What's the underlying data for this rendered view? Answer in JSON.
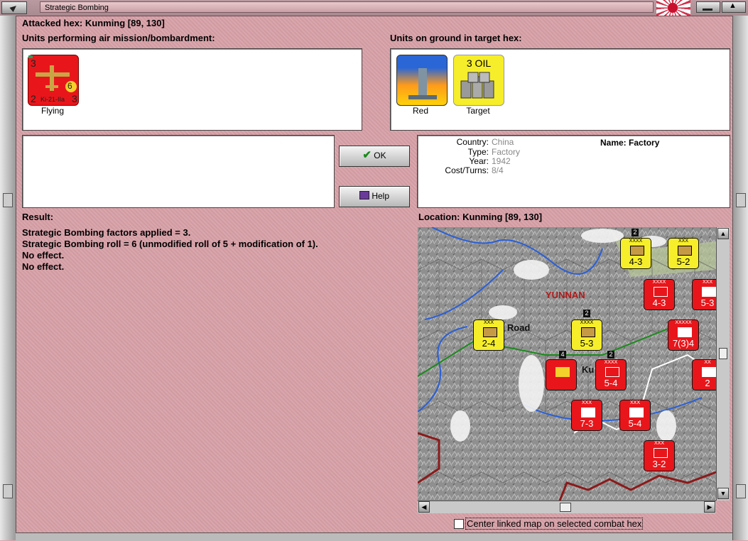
{
  "window": {
    "title": "Strategic Bombing"
  },
  "header": {
    "attacked_hex": "Attacked hex: Kunming  [89, 130]"
  },
  "air_units": {
    "label": "Units performing air mission/bombardment:",
    "items": [
      {
        "type": "Ki-21-IIa",
        "caption": "Flying",
        "top_left": "3",
        "bottom_left": "2",
        "bottom_right": "3",
        "value": "6"
      }
    ]
  },
  "ground_units": {
    "label": "Units on ground in target hex:",
    "items": [
      {
        "caption": "Red",
        "icon": "factory-smokestack-icon"
      },
      {
        "caption": "Target",
        "badge": "3 OIL",
        "icon": "oil-barrels-icon"
      }
    ]
  },
  "buttons": {
    "ok": "OK",
    "help": "Help"
  },
  "info": {
    "country_label": "Country:",
    "country": "China",
    "type_label": "Type:",
    "type": "Factory",
    "year_label": "Year:",
    "year": "1942",
    "cost_label": "Cost/Turns:",
    "cost": "8/4",
    "name_label": "Name: Factory"
  },
  "result": {
    "label": "Result:",
    "lines": [
      "Strategic Bombing factors applied = 3.",
      "Strategic Bombing roll = 6 (unmodified roll of 5 + modification of 1).",
      "No effect.",
      "No effect."
    ]
  },
  "location": {
    "label": "Location:  Kunming  [89, 130]"
  },
  "map": {
    "region_label": "YUNNAN",
    "road_label": "a Road",
    "city_label": "Ku",
    "counters": [
      {
        "color": "yellow",
        "stat": "4-3"
      },
      {
        "color": "yellow",
        "stat": "5-2"
      },
      {
        "color": "red",
        "stat": "4-3"
      },
      {
        "color": "red",
        "stat": "5-3"
      },
      {
        "color": "yellow",
        "stat": "2-4"
      },
      {
        "color": "yellow",
        "stat": "5-3"
      },
      {
        "color": "red",
        "stat": "7(3)4"
      },
      {
        "color": "red",
        "stat": "5-4"
      },
      {
        "color": "red",
        "stat": "2"
      },
      {
        "color": "red",
        "stat": "7-3"
      },
      {
        "color": "red",
        "stat": "5-4"
      },
      {
        "color": "red",
        "stat": "3-2"
      }
    ],
    "stack_numbers": [
      "2",
      "2",
      "4",
      "2"
    ]
  },
  "options": {
    "center_map": "Center linked map on selected combat hex"
  },
  "colors": {
    "frame": "#d8a1a8",
    "axis_red": "#e8161b",
    "china_yellow": "#f6ee2a"
  }
}
